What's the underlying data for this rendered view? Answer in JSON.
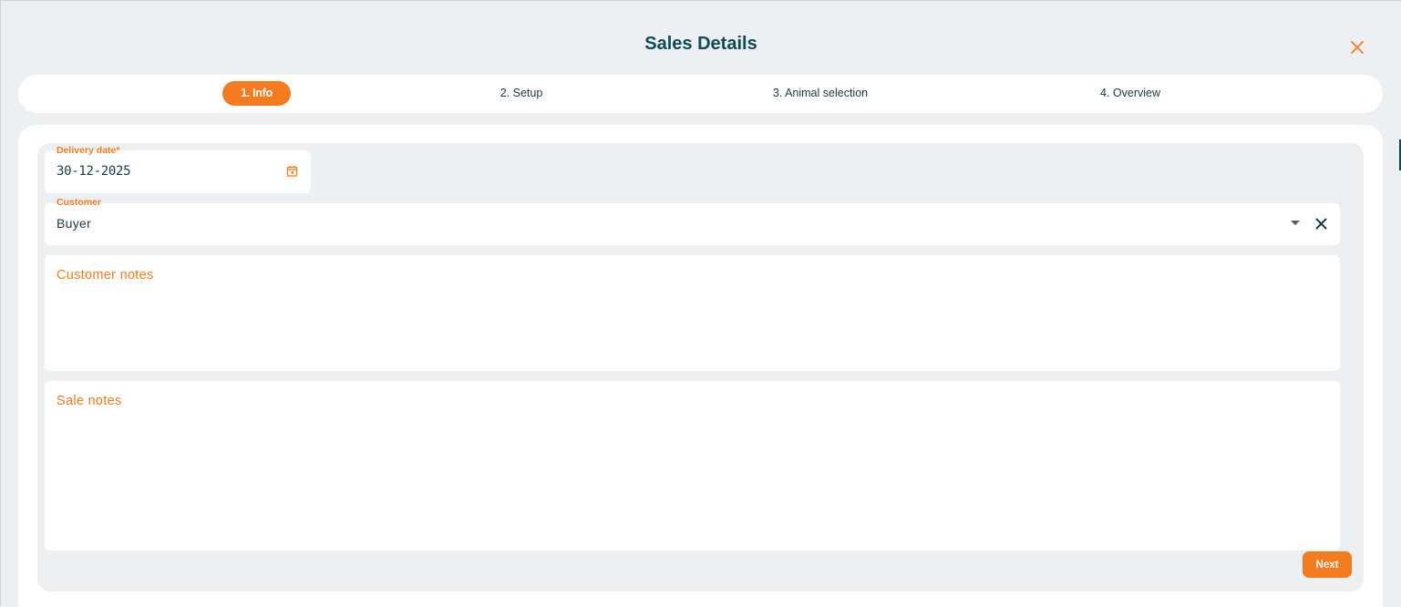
{
  "dialog": {
    "title": "Sales Details",
    "close_icon": "close-x-icon"
  },
  "stepper": {
    "steps": [
      {
        "label": "1. Info",
        "active": true
      },
      {
        "label": "2. Setup",
        "active": false
      },
      {
        "label": "3. Animal selection",
        "active": false
      },
      {
        "label": "4. Overview",
        "active": false
      }
    ]
  },
  "form": {
    "delivery_date": {
      "label": "Delivery date*",
      "value": "30-12-2025",
      "icon": "calendar-icon"
    },
    "customer": {
      "label": "Customer",
      "value": "Buyer",
      "icons": [
        "dropdown-arrow-icon",
        "clear-icon"
      ]
    },
    "customer_notes": {
      "placeholder": "Customer notes"
    },
    "sale_notes": {
      "placeholder": "Sale notes"
    },
    "next_label": "Next"
  },
  "colors": {
    "accent": "#f47b20",
    "title": "#0e4a57",
    "background": "#ecf0f3"
  }
}
